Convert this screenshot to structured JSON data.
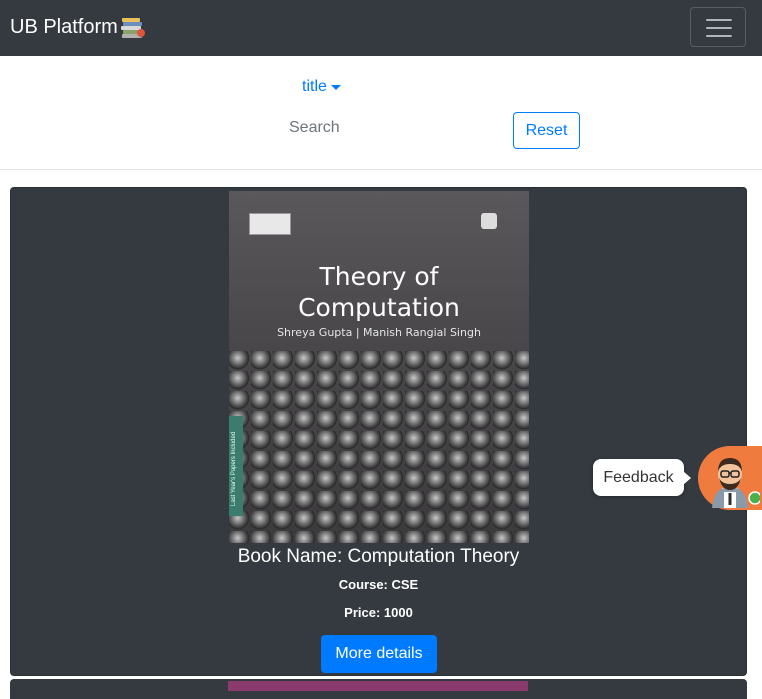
{
  "navbar": {
    "brand": "UB Platform",
    "brand_icon": "stack-of-books-icon",
    "toggler_icon": "hamburger-menu-icon"
  },
  "filter": {
    "dropdown_label": "title",
    "search_placeholder": "Search",
    "reset_label": "Reset"
  },
  "book": {
    "cover_title_line1": "Theory of",
    "cover_title_line2": "Computation",
    "cover_authors": "Shreya Gupta | Manish Rangial Singh",
    "cover_strip_text": "Last Year's Papers Included",
    "name": "Book Name: Computation Theory",
    "course": "Course: CSE",
    "price": "Price: 1000",
    "details_label": "More details"
  },
  "feedback": {
    "label": "Feedback",
    "avatar_icon": "support-agent-avatar-icon",
    "status_color": "#4caf50"
  },
  "colors": {
    "navbar_bg": "#343a40",
    "accent": "#007bff",
    "card_bg": "#343a40",
    "feedback_tab": "#f07b3f"
  }
}
